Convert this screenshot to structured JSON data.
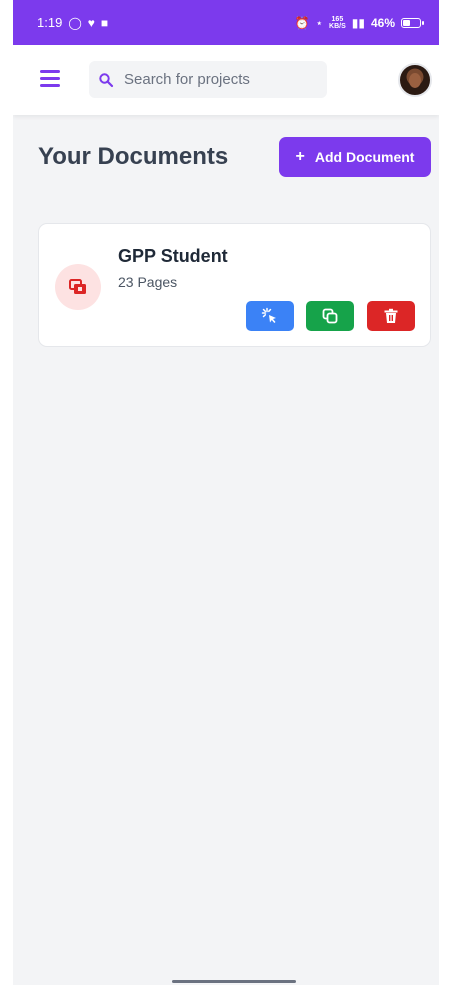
{
  "status_bar": {
    "time": "1:19",
    "battery": "46%",
    "net_speed_value": "165",
    "net_speed_unit": "KB/S"
  },
  "header": {
    "search_placeholder": "Search for projects"
  },
  "page": {
    "title": "Your Documents",
    "add_button_label": "Add Document"
  },
  "documents": [
    {
      "title": "GPP Student",
      "pages": "23 Pages"
    }
  ],
  "colors": {
    "primary": "#7c3aed",
    "open": "#3b82f6",
    "copy": "#16a34a",
    "delete": "#dc2626",
    "icon_bg": "#fde2e2"
  },
  "icons": {
    "menu": "hamburger-menu-icon",
    "search": "search-icon",
    "theme": "moon-icon",
    "document": "documents-icon",
    "open": "cursor-click-icon",
    "copy": "copy-icon",
    "delete": "trash-icon"
  }
}
